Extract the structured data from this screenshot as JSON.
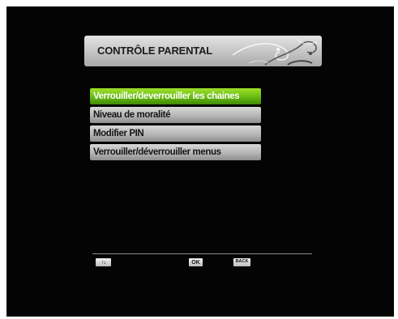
{
  "header": {
    "title": "CONTRÔLE PARENTAL",
    "decoration_icon": "swirl-ornament"
  },
  "menu": {
    "items": [
      {
        "label": "Verrouiller/deverrouiller les chaines",
        "selected": true
      },
      {
        "label": "Niveau de moralité",
        "selected": false
      },
      {
        "label": "Modifier PIN",
        "selected": false
      },
      {
        "label": "Verrouiller/déverrouiller menus",
        "selected": false
      }
    ]
  },
  "footer": {
    "nav_key_icon": "up-down-arrows-icon",
    "nav_key_label": "↑↓",
    "ok_key_label": "OK",
    "back_key_label": "BACK"
  },
  "colors": {
    "screen_background": "#040404",
    "selected_item": "#6cbf14",
    "item_background": "#b5b5b5",
    "title_bar": "#c4c4c4"
  }
}
